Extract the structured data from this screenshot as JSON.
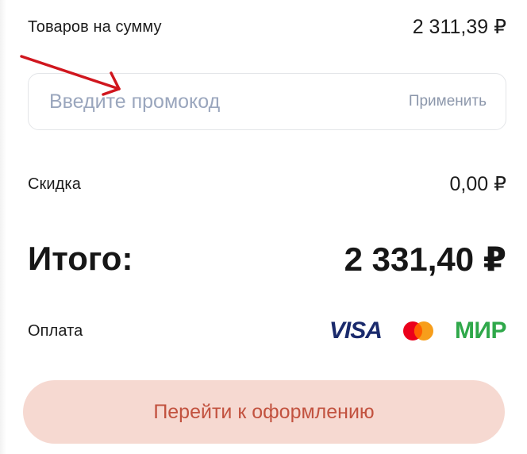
{
  "summary": {
    "subtotal_label": "Товаров на сумму",
    "subtotal_value": "2 311,39 ₽",
    "discount_label": "Скидка",
    "discount_value": "0,00 ₽",
    "total_label": "Итого:",
    "total_value": "2 331,40 ₽"
  },
  "promo": {
    "placeholder": "Введите промокод",
    "value": "",
    "apply_label": "Применить"
  },
  "payment": {
    "label": "Оплата",
    "methods": [
      {
        "name": "VISA",
        "icon": "visa-icon",
        "color": "#1a2a6c"
      },
      {
        "name": "Mastercard",
        "icon": "mastercard-icon",
        "colors": [
          "#eb001b",
          "#f79e1b"
        ]
      },
      {
        "name": "МИР",
        "icon": "mir-icon",
        "color": "#2fa84a"
      }
    ],
    "visa_text": "VISA",
    "mir_text": "МИР"
  },
  "checkout": {
    "label": "Перейти к оформлению",
    "background": "#f6d9d1",
    "text_color": "#c2523f"
  },
  "annotation": {
    "icon": "red-arrow-icon",
    "color": "#d0161e"
  }
}
